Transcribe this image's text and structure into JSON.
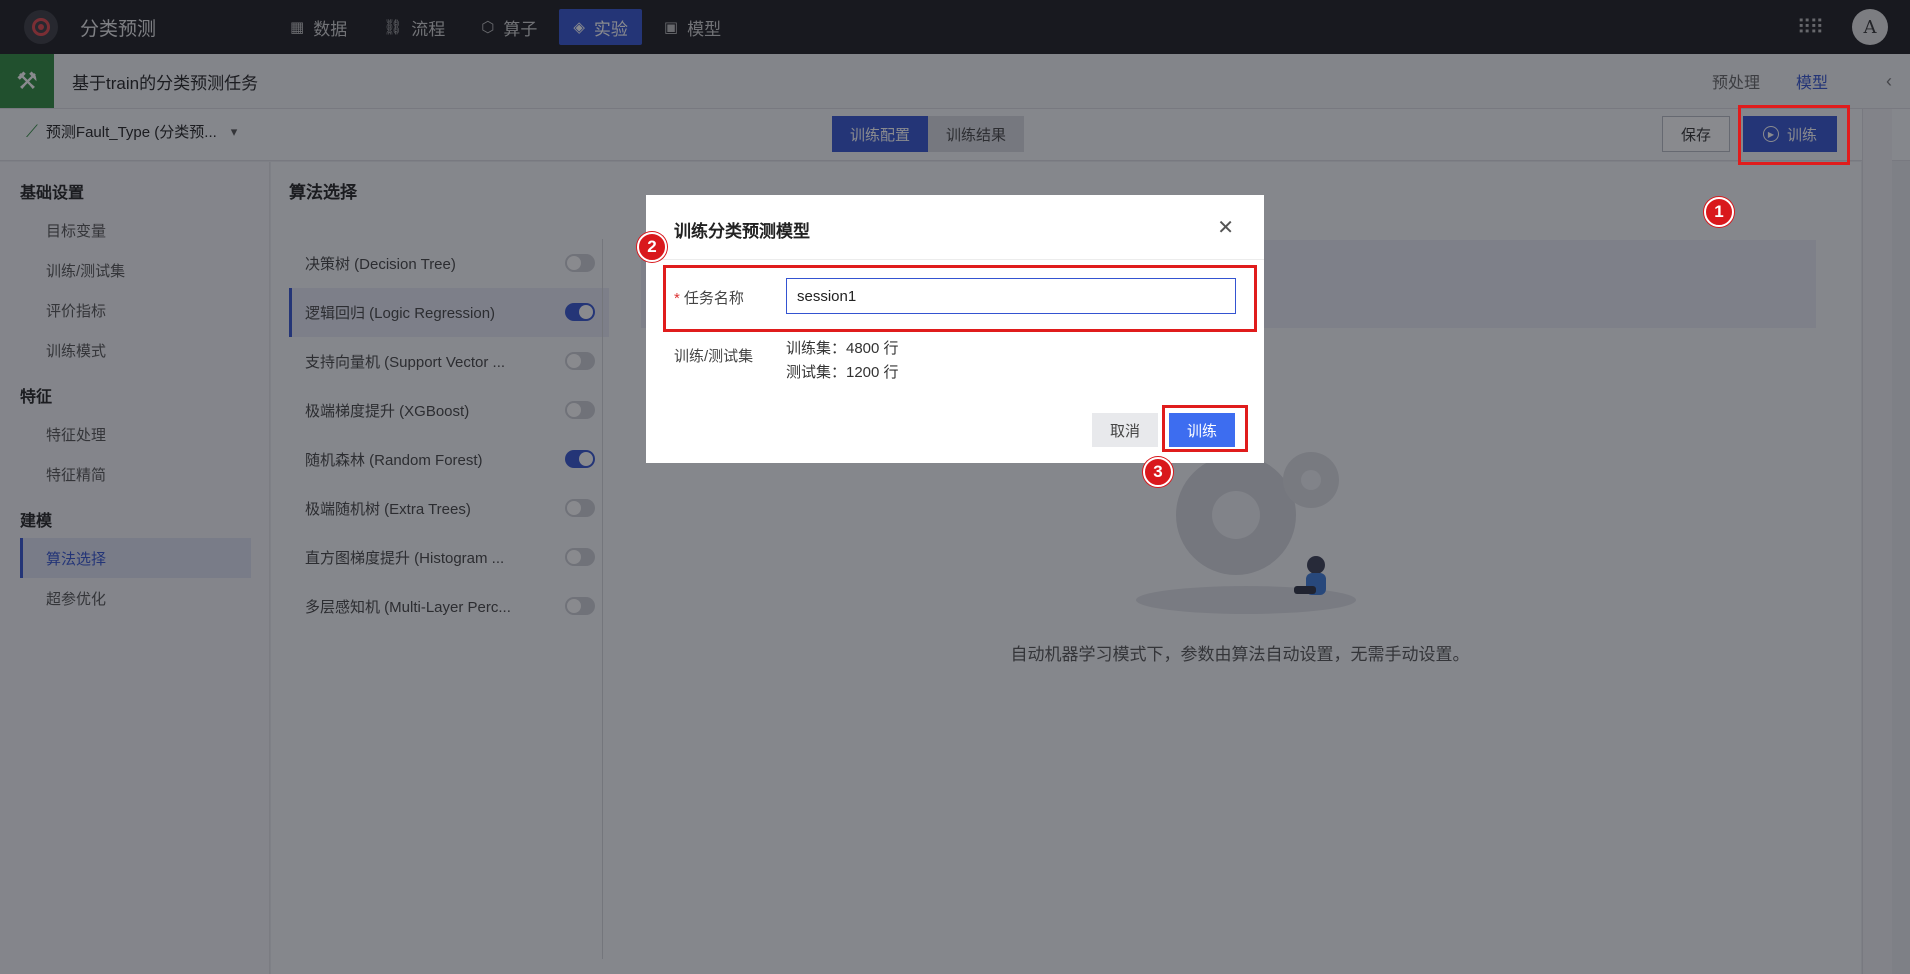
{
  "app": {
    "title": "分类预测"
  },
  "nav": [
    {
      "label": "数据",
      "icon": "table-icon"
    },
    {
      "label": "流程",
      "icon": "flow-icon"
    },
    {
      "label": "算子",
      "icon": "operator-icon"
    },
    {
      "label": "实验",
      "icon": "cube-icon",
      "active": true
    },
    {
      "label": "模型",
      "icon": "save-icon"
    }
  ],
  "user": {
    "avatar_letter": "A"
  },
  "task": {
    "title": "基于train的分类预测任务",
    "tabs": [
      "预处理",
      "模型"
    ],
    "active_tab": "模型"
  },
  "toolbar": {
    "target_label": "预测Fault_Type (分类预...",
    "seg_tabs": [
      "训练配置",
      "训练结果"
    ],
    "save_label": "保存",
    "train_label": "训练"
  },
  "sidebar": {
    "groups": [
      {
        "title": "基础设置",
        "items": [
          "目标变量",
          "训练/测试集",
          "评价指标",
          "训练模式"
        ]
      },
      {
        "title": "特征",
        "items": [
          "特征处理",
          "特征精简"
        ]
      },
      {
        "title": "建模",
        "items": [
          "算法选择",
          "超参优化"
        ]
      }
    ],
    "active_item": "算法选择"
  },
  "main": {
    "heading": "算法选择",
    "algorithms": [
      {
        "label": "决策树 (Decision Tree)",
        "enabled": false
      },
      {
        "label": "逻辑回归 (Logic Regression)",
        "enabled": true
      },
      {
        "label": "支持向量机 (Support Vector ...",
        "enabled": false
      },
      {
        "label": "极端梯度提升 (XGBoost)",
        "enabled": false
      },
      {
        "label": "随机森林 (Random Forest)",
        "enabled": true
      },
      {
        "label": "极端随机树 (Extra Trees)",
        "enabled": false
      },
      {
        "label": "直方图梯度提升 (Histogram ...",
        "enabled": false
      },
      {
        "label": "多层感知机 (Multi-Layer Perc...",
        "enabled": false
      }
    ],
    "empty_message": "自动机器学习模式下，参数由算法自动设置，无需手动设置。"
  },
  "modal": {
    "title": "训练分类预测模型",
    "name_label": "任务名称",
    "name_value": "session1",
    "split_label": "训练/测试集",
    "train_count": "训练集：4800 行",
    "test_count": "测试集：1200 行",
    "cancel_label": "取消",
    "train_label": "训练"
  },
  "annotations": {
    "steps": [
      "1",
      "2",
      "3"
    ],
    "color": "#e01c1c"
  },
  "colors": {
    "accent": "#3454d1",
    "topbar": "#1c1d21",
    "task_icon_bg": "#2e8b3f"
  }
}
